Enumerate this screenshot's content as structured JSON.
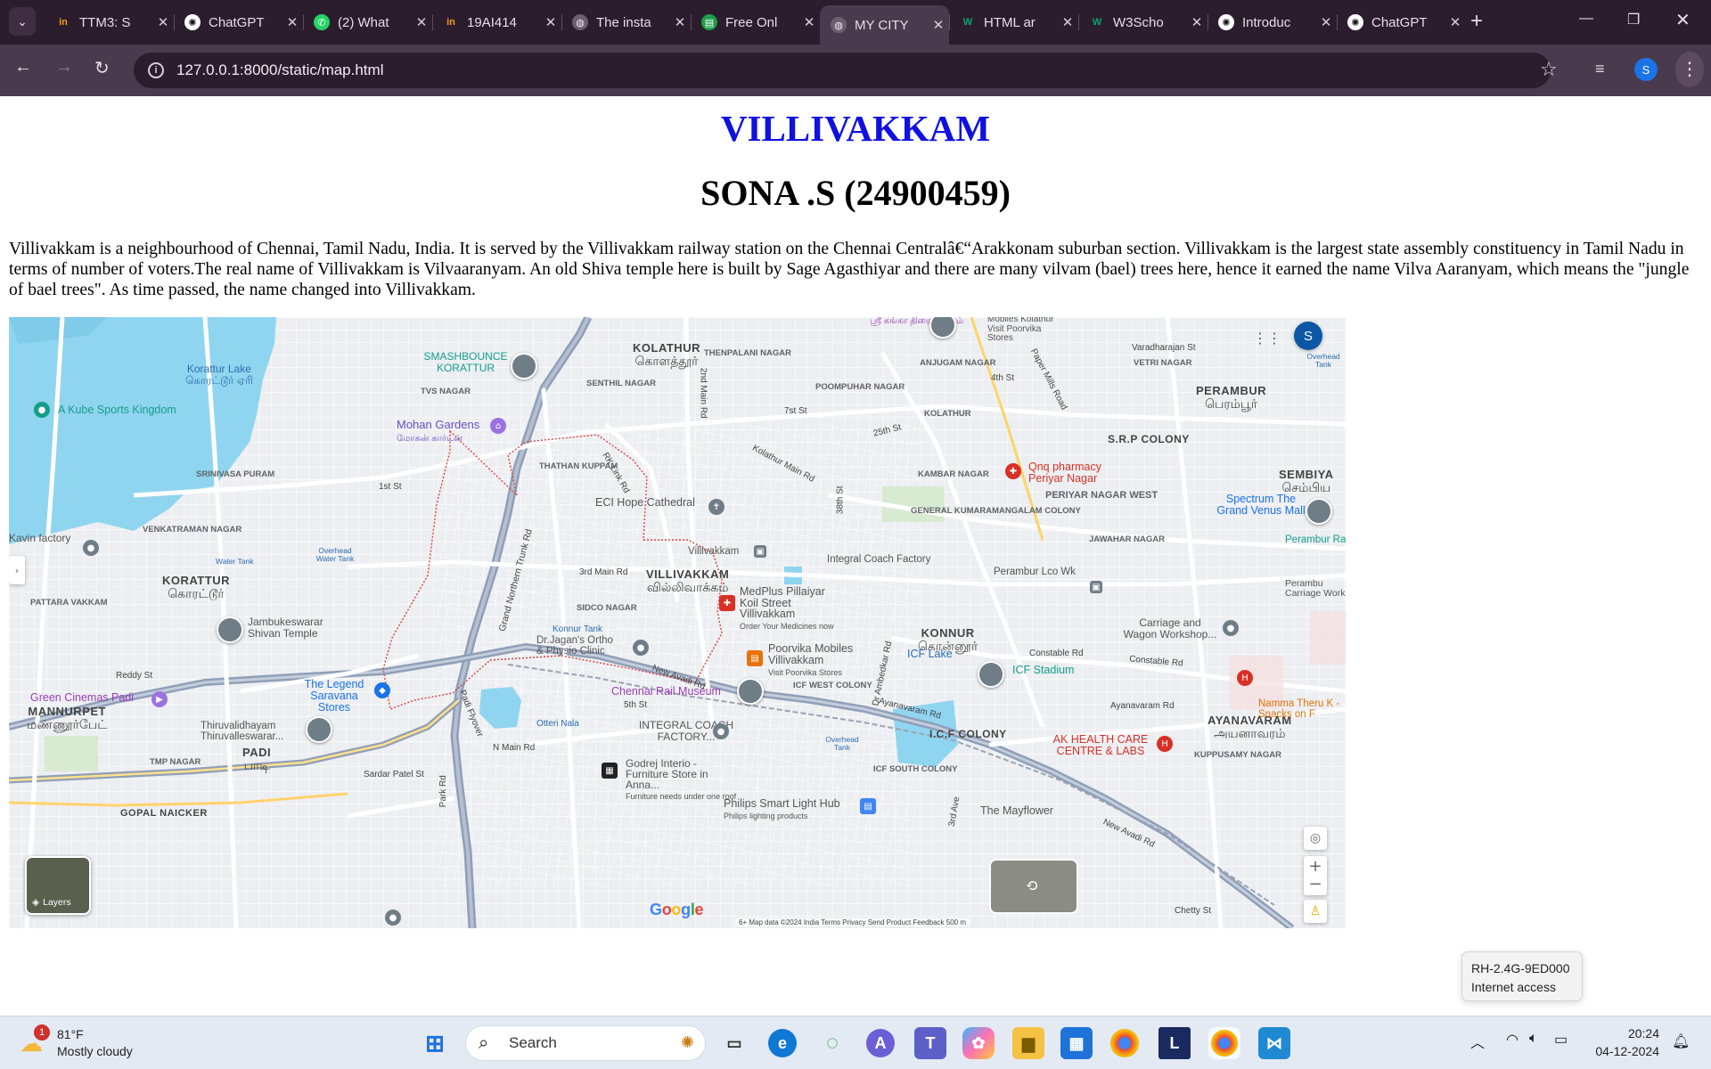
{
  "browser": {
    "tabs": [
      {
        "label": "TTM3: S",
        "icon": "naukri-icon",
        "active": false
      },
      {
        "label": "ChatGPT",
        "icon": "chatgpt-icon",
        "active": false
      },
      {
        "label": "(2) What",
        "icon": "whatsapp-icon",
        "active": false
      },
      {
        "label": "19AI414",
        "icon": "naukri-icon",
        "active": false
      },
      {
        "label": "The insta",
        "icon": "globe-icon",
        "active": false
      },
      {
        "label": "Free Onl",
        "icon": "sheet-icon",
        "active": false
      },
      {
        "label": "MY CITY",
        "icon": "globe-icon",
        "active": true
      },
      {
        "label": "HTML ar",
        "icon": "w3schools-icon",
        "active": false
      },
      {
        "label": "W3Scho",
        "icon": "w3schools-icon",
        "active": false
      },
      {
        "label": "Introduc",
        "icon": "chatgpt-icon",
        "active": false
      },
      {
        "label": "ChatGPT",
        "icon": "chatgpt-icon",
        "active": false
      }
    ],
    "url": "127.0.0.1:8000/static/map.html",
    "profile_initial": "S"
  },
  "page": {
    "title": "VILLIVAKKAM",
    "subtitle": "SONA .S (24900459)",
    "paragraph": "Villivakkam is a neighbourhood of Chennai, Tamil Nadu, India. It is served by the Villivakkam railway station on the Chennai Centralâ€“Arakkonam suburban section. Villivakkam is the largest state assembly constituency in Tamil Nadu in terms of number of voters.The real name of Villivakkam is Vilvaaranyam. An old Shiva temple here is built by Sage Agasthiyar and there are many vilvam (bael) trees here, hence it earned the name Vilva Aaranyam, which means the \"jungle of bael trees\". As time passed, the name changed into Villivakkam."
  },
  "map": {
    "areas": {
      "kolathur": "KOLATHUR",
      "kolathur_ta": "கொளத்தூர்",
      "villivakkam": "VILLIVAKKAM",
      "villivakkam_ta": "வில்லிவாக்கம்",
      "korattur": "KORATTUR",
      "korattur_ta": "கொரட்டூர்",
      "konnur": "KONNUR",
      "konnur_ta": "கொன்னூர்",
      "perambur": "PERAMBUR",
      "perambur_ta": "பெரம்பூர்",
      "sembiya": "SEMBIYA",
      "sembiya_ta": "செம்பிய",
      "ayanavaram": "AYANAVARAM",
      "ayanavaram_ta": "அயனாவரம்",
      "padi": "PADI",
      "padi_ta": "பாடி",
      "mannurpet": "MANNURPET",
      "mannurpet_ta": "மண்ணூர்பேட்",
      "srp_colony": "S.R.P COLONY",
      "icf_colony": "I.C.F COLONY",
      "gopal_naicker": "GOPAL NAICKER"
    },
    "small_areas": {
      "thenpalani": "THENPALANI NAGAR",
      "senthil": "SENTHIL NAGAR",
      "tvs": "TVS NAGAR",
      "poompuhar": "POOMPUHAR NAGAR",
      "anjugam": "ANJUGAM NAGAR",
      "vetri": "VETRI NAGAR",
      "kolathur_small": "KOLATHUR",
      "srinivasa": "SRINIVASA PURAM",
      "thathan": "THATHAN KUPPAM",
      "kambar": "KAMBAR NAGAR",
      "periyar": "PERIYAR NAGAR WEST",
      "general": "GENERAL KUMARAMANGALAM COLONY",
      "venkatraman": "VENKATRAMAN NAGAR",
      "sidco": "SIDCO NAGAR",
      "pattara": "PATTARA VAKKAM",
      "jawahar": "JAWAHAR NAGAR",
      "icf_west": "ICF WEST COLONY",
      "icf_south": "ICF SOUTH COLONY",
      "tmp": "TMP NAGAR",
      "kuppusamy": "KUPPUSAMY NAGAR"
    },
    "roads": {
      "kolathur_main": "Kolathur Main Rd",
      "second_main": "2nd Main Rd",
      "first_st": "1st St",
      "gnt": "Grand Northern Trunk Rd",
      "third_main": "3rd Main Rd",
      "new_avadi": "New Avadi Rd",
      "ambedkar": "Dr Ambedkar Rd",
      "constable": "Constable Rd",
      "ayanavaram_rd": "Ayanavaram Rd",
      "padi_flyover": "Padi Flyover",
      "n_main": "N Main Rd",
      "sardar": "Sardar Patel St",
      "park": "Park Rd",
      "paper_mills": "Paper Mills Road",
      "varadharajan": "Varadharajan St",
      "thirtyeighth": "38th St",
      "rk_link": "RK Link Rd",
      "fourth_st": "4th St",
      "twentyfifth": "25th St",
      "seventh": "7st St",
      "otteri": "Otteri Nala",
      "third_ave": "3rd Ave",
      "fifth": "5th St"
    },
    "water": {
      "korattur_lake": "Korattur Lake",
      "korattur_lake_ta": "கொரட்டூர் ஏரி",
      "icf_lake": "ICF Lake",
      "konnur_tank": "Konnur Tank",
      "overhead1": "Overhead Water Tank",
      "overhead2": "Overhead Tank",
      "overhead3": "Overhead Tank",
      "water_tank": "Water Tank"
    },
    "pois": {
      "kube": "A Kube Sports Kingdom",
      "smashbounce": "SMASHBOUNCE KORATTUR",
      "mohan": "Mohan Gardens",
      "mohan_ta": "மோகன் கார்டன்",
      "ecl": "ECI Hope Cathedral",
      "villivakkam_stn": "Villivakkam",
      "integral": "Integral Coach Factory",
      "medplus": "MedPlus Pillaiyar Koil Street Villivakkam",
      "medplus_sub": "Order Your Medicines now",
      "poorvika": "Poorvika Mobiles Villivakkam",
      "poorvika_sub": "Visit Poorvika Stores",
      "jagan": "Dr.Jagan's Ortho & Physio Clinic",
      "chennai_rail": "Chennai Rail Museum",
      "integral_factory": "INTEGRAL COACH FACTORY...",
      "godrej": "Godrej Interio - Furniture Store in Anna...",
      "godrej_sub": "Furniture needs under one roof",
      "philips": "Philips Smart Light Hub",
      "philips_sub": "Philips lighting products",
      "mayflower": "The Mayflower",
      "legend": "The Legend Saravana Stores",
      "green": "Green Cinemas Padi",
      "thiruvalidhayam": "Thiruvalidhayam Thiruvalleswarar...",
      "jambukeswarar": "Jambukeswarar Shivan Temple",
      "qnq": "Qnq pharmacy Periyar Nagar",
      "spectrum": "Spectrum The Grand Venus Mall",
      "perambur_lco": "Perambur Lco Wk",
      "carriage": "Carriage and Wagon Workshop...",
      "icf_stadium": "ICF Stadium",
      "ak_health": "AK HEALTH CARE CENTRE & LABS",
      "namma": "Namma Theru K - Snacks on F",
      "kavin": "Kavin factory",
      "perambur_rly": "Perambur Railway Stad",
      "perambur_carriage": "Perambu Carriage Work",
      "sri_ganga": "ஸ்ரீ கங்கா திரையரங்கம்",
      "poorvika_top": "Mobiles Kolathur Visit Poorvika Stores",
      "reddy": "Reddy St",
      "chetty": "Chetty St"
    },
    "controls": {
      "layers": "Layers",
      "zoom_in": "+",
      "zoom_out": "−",
      "google": "Google",
      "attribution": "6+ Map data ©2024   India   Terms   Privacy   Send Product Feedback   500 m",
      "profile": "S"
    }
  },
  "tooltip": {
    "network": "RH-2.4G-9ED000",
    "status": "Internet access"
  },
  "taskbar": {
    "weather_temp": "81°F",
    "weather_desc": "Mostly cloudy",
    "weather_badge": "1",
    "search": "Search",
    "time": "20:24",
    "date": "04-12-2024"
  },
  "colors": {
    "tabbar": "#2b1d2e",
    "addrbar": "#4a3a4d",
    "heading_blue": "#1010e0",
    "map_water": "#90d5f0",
    "map_road": "#ffffff",
    "map_highway": "#8f9fb8",
    "boundary": "#d94040"
  }
}
